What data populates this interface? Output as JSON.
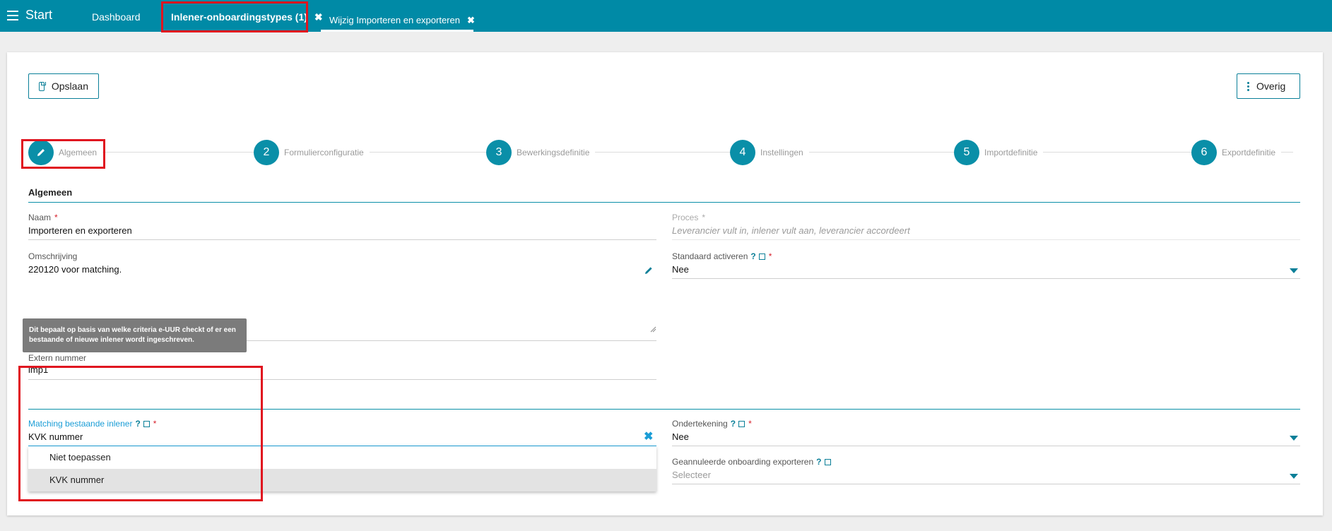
{
  "topbar": {
    "start_label": "Start",
    "tabs": [
      {
        "label": "Dashboard"
      },
      {
        "label": "Inlener-onboardingstypes (1)",
        "close": "✖"
      },
      {
        "label": "Wijzig Importeren en exporteren",
        "close": "✖"
      }
    ]
  },
  "toolbar": {
    "save_label": "Opslaan",
    "more_label": "Overig"
  },
  "stepper": [
    {
      "number": "",
      "label": "Algemeen"
    },
    {
      "number": "2",
      "label": "Formulierconfiguratie"
    },
    {
      "number": "3",
      "label": "Bewerkingsdefinitie"
    },
    {
      "number": "4",
      "label": "Instellingen"
    },
    {
      "number": "5",
      "label": "Importdefinitie"
    },
    {
      "number": "6",
      "label": "Exportdefinitie"
    }
  ],
  "section": {
    "title": "Algemeen"
  },
  "fields": {
    "naam": {
      "label": "Naam",
      "required": "*",
      "value": "Importeren en exporteren"
    },
    "proces": {
      "label": "Proces",
      "required": "*",
      "value": "Leverancier vult in, inlener vult aan, leverancier accordeert"
    },
    "omschrijving": {
      "label": "Omschrijving",
      "value": "220120 voor matching."
    },
    "standaard": {
      "label": "Standaard activeren",
      "help": "?",
      "required": "*",
      "value": "Nee"
    },
    "extern": {
      "label": "Extern nummer",
      "value": "imp1"
    },
    "matching": {
      "label": "Matching bestaande inlener",
      "help": "?",
      "required": "*",
      "value": "KVK nummer"
    },
    "ondertekening": {
      "label": "Ondertekening",
      "help": "?",
      "required": "*",
      "value": "Nee"
    },
    "geannuleerd": {
      "label": "Geannuleerde onboarding exporteren",
      "help": "?",
      "placeholder": "Selecteer"
    }
  },
  "tooltip": {
    "text": "Dit bepaalt op basis van welke criteria e-UUR checkt of er een bestaande of nieuwe inlener wordt ingeschreven."
  },
  "dropdown": {
    "options": [
      "Niet toepassen",
      "KVK nummer"
    ],
    "selected": "KVK nummer"
  },
  "colors": {
    "brand": "#008aa6",
    "accent": "#0a8fa8",
    "required": "#d61f2a",
    "highlight": "#e0141f"
  }
}
